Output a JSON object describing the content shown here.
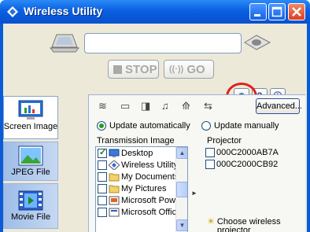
{
  "window": {
    "title": "Wireless Utility",
    "controls": [
      "minimize-icon",
      "maximize-icon",
      "close-icon"
    ]
  },
  "toolbar": {
    "stop_label": "STOP",
    "go_label": "GO",
    "small_buttons": [
      "settings-icon",
      "help-icon",
      "about-icon"
    ],
    "advanced_label": "Advanced..."
  },
  "sidebar": {
    "tabs": [
      {
        "label": "Screen Image",
        "icon": "screen-image-icon",
        "active": true
      },
      {
        "label": "JPEG File",
        "icon": "jpeg-file-icon",
        "active": false
      },
      {
        "label": "Movie File",
        "icon": "movie-file-icon",
        "active": false
      }
    ]
  },
  "panel": {
    "update_auto_label": "Update automatically",
    "update_manual_label": "Update manually",
    "update_mode": "auto",
    "transmission_label": "Transmission Image",
    "projector_label": "Projector",
    "transmission_items": [
      {
        "label": "Desktop",
        "checked": true
      },
      {
        "label": "Wireless Utility",
        "checked": false
      },
      {
        "label": "My Documents",
        "checked": false
      },
      {
        "label": "My Pictures",
        "checked": false
      },
      {
        "label": "Microsoft Powe",
        "checked": false
      },
      {
        "label": "Microsoft Office",
        "checked": false
      }
    ],
    "projectors": [
      {
        "label": "000C2000AB7A",
        "checked": false
      },
      {
        "label": "000C2000CB92",
        "checked": false
      }
    ],
    "choose_line1": "Choose wireless",
    "choose_line2": "projector"
  },
  "colors": {
    "titlebar": "#0a5fe0",
    "face": "#ece9d8",
    "highlight_ring": "#e0201a"
  }
}
